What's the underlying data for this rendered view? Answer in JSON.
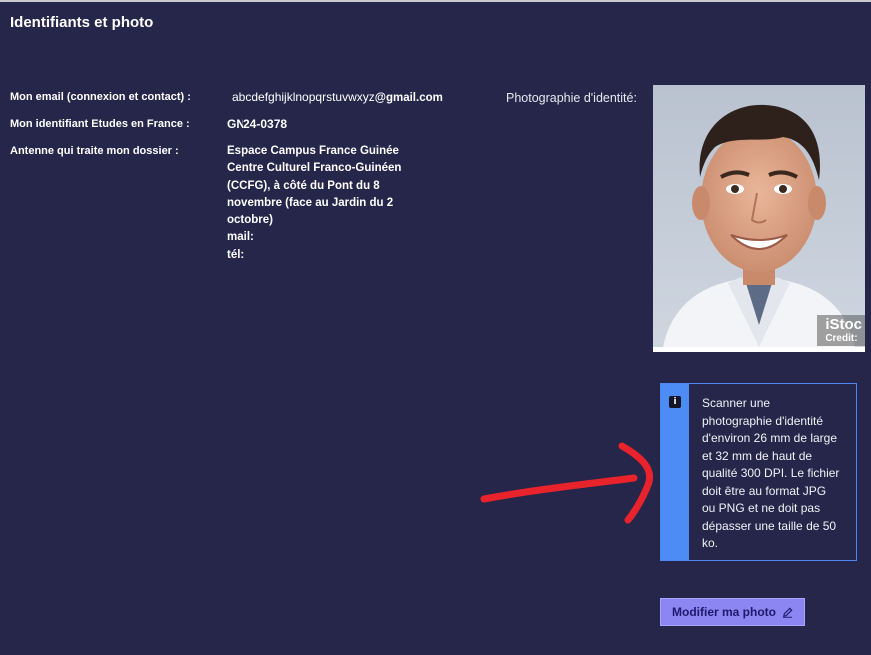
{
  "section": {
    "title": "Identifiants et photo"
  },
  "fields": {
    "email_label": "Mon email (connexion et contact) :",
    "email_user": "abcdefghijklnopqrstuvwxyz",
    "email_domain": "@gmail.com",
    "identifier_label": "Mon identifiant Etudes en France :",
    "identifier_prefix": "GN",
    "identifier_value": "24-0378",
    "antenna_label": "Antenne qui traite mon dossier :",
    "antenna_lines": [
      "Espace Campus France Guinée",
      "Centre Culturel Franco-Guinéen",
      "(CCFG), à côté du Pont du 8",
      "novembre (face au Jardin du 2",
      "octobre)",
      "mail:",
      "tél:"
    ]
  },
  "photo": {
    "label": "Photographie d'identité:",
    "watermark_brand": "iStoc",
    "watermark_credit": "Credit:"
  },
  "info_box": {
    "icon": "info-icon",
    "text": "Scanner une photographie d'identité d'environ 26 mm de large et 32 mm de haut de qualité 300 DPI. Le fichier doit être au format JPG ou PNG et ne doit pas dépasser une taille de 50 ko."
  },
  "button": {
    "label": "Modifier ma photo",
    "icon": "pencil-icon"
  },
  "colors": {
    "background": "#25264a",
    "accent_blue": "#4d8cf5",
    "button_bg": "#8b86f2",
    "button_text": "#1d1a6b",
    "annotation_red": "#e8232b"
  }
}
